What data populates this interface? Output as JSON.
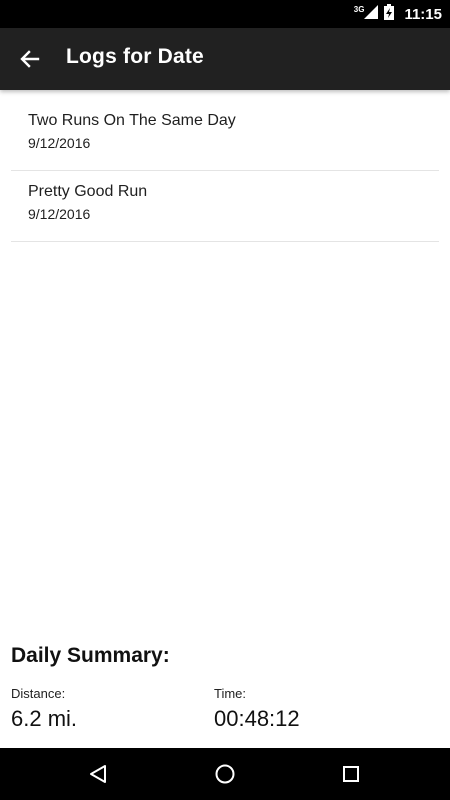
{
  "status_bar": {
    "network": "3G",
    "time": "11:15"
  },
  "app_bar": {
    "title": "Logs for Date"
  },
  "logs": [
    {
      "title": "Two Runs On The Same Day",
      "date": "9/12/2016"
    },
    {
      "title": "Pretty Good Run",
      "date": "9/12/2016"
    }
  ],
  "summary": {
    "title": "Daily Summary:",
    "distance_label": "Distance:",
    "distance_value": "6.2 mi.",
    "time_label": "Time:",
    "time_value": "00:48:12"
  },
  "icons": {
    "back": "arrow-left-icon",
    "nav_back": "triangle-back-icon",
    "nav_home": "circle-home-icon",
    "nav_recents": "square-recents-icon"
  }
}
